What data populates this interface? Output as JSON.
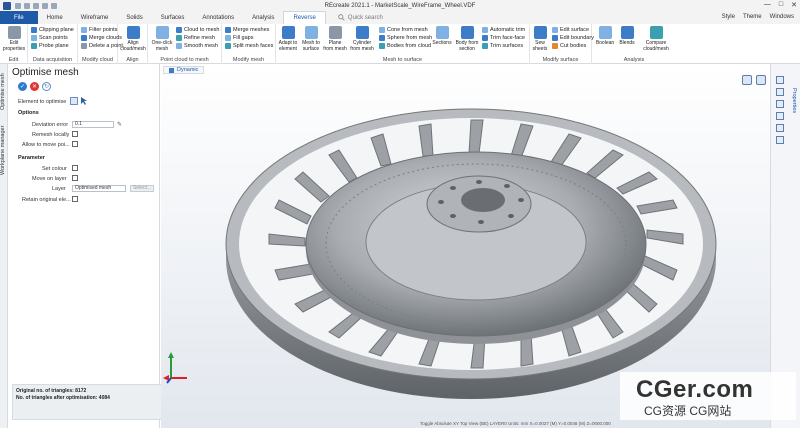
{
  "window": {
    "title": "REcreate 2021.1 - MarketScale_WireFrame_Wheel.VDF",
    "controls": [
      "—",
      "□",
      "✕"
    ]
  },
  "ribbon_tabs": [
    "File",
    "Home",
    "Wireframe",
    "Solids",
    "Surfaces",
    "Annotations",
    "Analysis",
    "Reverse"
  ],
  "active_tab": "Reverse",
  "search_placeholder": "Quick search",
  "tabs_right": [
    "Style",
    "Theme",
    "Windows"
  ],
  "ribbon": {
    "edit": {
      "big": "Edit properties",
      "label": "Edit"
    },
    "data_acquisition": {
      "items": [
        "Clipping plane",
        "Scan points",
        "Probe plane"
      ],
      "label": "Data acquisition"
    },
    "modify_cloud": {
      "items": [
        "Filter points",
        "Merge clouds",
        "Delete a point"
      ],
      "label": "Modify cloud"
    },
    "align": {
      "big": "Align cloud/mesh",
      "label": "Align"
    },
    "point_cloud_to_mesh": {
      "big": "One-click mesh",
      "items": [
        "Cloud to mesh",
        "Refine mesh",
        "Smooth mesh"
      ],
      "label": "Point cloud to mesh"
    },
    "modify_mesh": {
      "items": [
        "Merge meshes",
        "Fill gaps",
        "Split mesh faces"
      ],
      "label": "Modify mesh"
    },
    "mesh_to_surface": {
      "bigs": [
        "Adapt to element",
        "Mesh to surface",
        "Plane from mesh",
        "Cylinder from mesh"
      ],
      "items": [
        "Cone from mesh",
        "Sphere from mesh",
        "Bodies from cloud"
      ],
      "bigs2": [
        "Sections",
        "Body from section"
      ],
      "items2": [
        "Automatic trim",
        "Trim face-face",
        "Trim surfaces"
      ],
      "label": "Mesh to surface"
    },
    "modify_surface": {
      "big": "Sew sheets",
      "items": [
        "Edit surface",
        "Edit boundary",
        "Cut bodies"
      ],
      "label": "Modify surface"
    },
    "analysis": {
      "bigs": [
        "Boolean",
        "Blends",
        "Compare cloud/mesh"
      ],
      "label": "Analysis"
    }
  },
  "left_tabs": [
    "Optimise mesh",
    "Workplane manager"
  ],
  "panel": {
    "title": "Optimise mesh",
    "element_label": "Element to optimise",
    "options_header": "Options",
    "deviation_label": "Deviation error",
    "deviation_value": "0.1",
    "remesh_label": "Remesh locally",
    "allow_label": "Allow to move poi...",
    "parameter_header": "Parameter",
    "set_colour_label": "Set colour",
    "move_layer_label": "Move on layer",
    "layer_label": "Layer",
    "layer_value": "Optimised mesh",
    "select_label": "Select...",
    "retain_label": "Retain original ele...",
    "info_original": "Original no. of triangles: 8172",
    "info_after": "No. of triangles after optimisation: 4084"
  },
  "viewport": {
    "tab": "Dynamic"
  },
  "right_tabs": [
    "Properties"
  ],
  "status": "Toggle   Absolute XY Top   View (BE)   LAYER0   Units: mm   X=0.0027 (M)   Y=0.0048 (M)   Z=0000.000",
  "watermark": {
    "line1": "CGer.com",
    "line2": "CG资源 CG网站"
  }
}
